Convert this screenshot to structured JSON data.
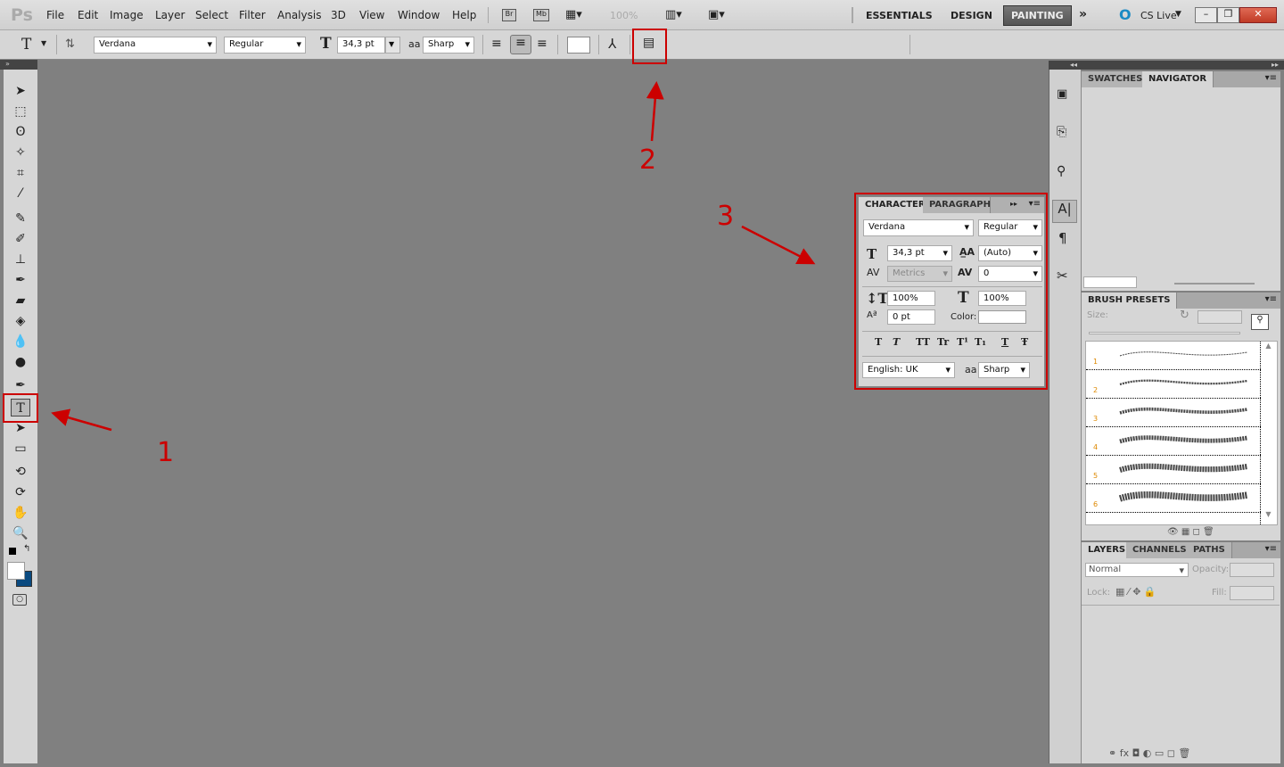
{
  "app": {
    "logo": "Ps"
  },
  "menu": [
    "File",
    "Edit",
    "Image",
    "Layer",
    "Select",
    "Filter",
    "Analysis",
    "3D",
    "View",
    "Window",
    "Help"
  ],
  "appbar": {
    "bridge": "Br",
    "minibridge": "Mb",
    "zoom": "100%"
  },
  "workspaces": {
    "essentials": "ESSENTIALS",
    "design": "DESIGN",
    "painting": "PAINTING",
    "more": "»",
    "cslive": "CS Live"
  },
  "options": {
    "tool_icon": "T",
    "font_family": "Verdana",
    "font_style": "Regular",
    "font_size": "34,3 pt",
    "aa_icon": "aa",
    "antialias": "Sharp"
  },
  "tools": [
    "move-tool",
    "marquee-tool",
    "lasso-tool",
    "quick-select-tool",
    "crop-tool",
    "eyedropper-tool",
    "healing-brush-tool",
    "brush-tool",
    "clone-stamp-tool",
    "history-brush-tool",
    "eraser-tool",
    "paint-bucket-tool",
    "blur-tool",
    "dodge-tool",
    "pen-tool",
    "type-tool",
    "path-selection-tool",
    "rectangle-tool",
    "3d-rotate-tool",
    "3d-orbit-tool",
    "hand-tool",
    "zoom-tool"
  ],
  "colors": {
    "foreground": "#ffffff",
    "background": "#0a4a80",
    "annotation": "#cc0000"
  },
  "navigator_panel": {
    "tabs": [
      "SWATCHES",
      "NAVIGATOR"
    ],
    "active": "NAVIGATOR"
  },
  "character_panel": {
    "tabs": [
      "CHARACTER",
      "PARAGRAPH"
    ],
    "font_family": "Verdana",
    "font_style": "Regular",
    "size": "34,3 pt",
    "leading": "(Auto)",
    "kerning": "Metrics",
    "tracking": "0",
    "vscale": "100%",
    "hscale": "100%",
    "baseline": "0 pt",
    "color_label": "Color:",
    "style_buttons": [
      "T",
      "T",
      "TT",
      "Tr",
      "T¹",
      "T₁",
      "T",
      "Ŧ"
    ],
    "language": "English: UK",
    "aa_icon": "aa",
    "antialias": "Sharp"
  },
  "brush_panel": {
    "title": "BRUSH PRESETS",
    "size_label": "Size:",
    "presets": [
      "1",
      "2",
      "3",
      "4",
      "5",
      "6"
    ]
  },
  "layers_panel": {
    "tabs": [
      "LAYERS",
      "CHANNELS",
      "PATHS"
    ],
    "blend_mode": "Normal",
    "opacity_label": "Opacity:",
    "lock_label": "Lock:",
    "fill_label": "Fill:"
  },
  "annotations": {
    "one": "1",
    "two": "2",
    "three": "3"
  }
}
